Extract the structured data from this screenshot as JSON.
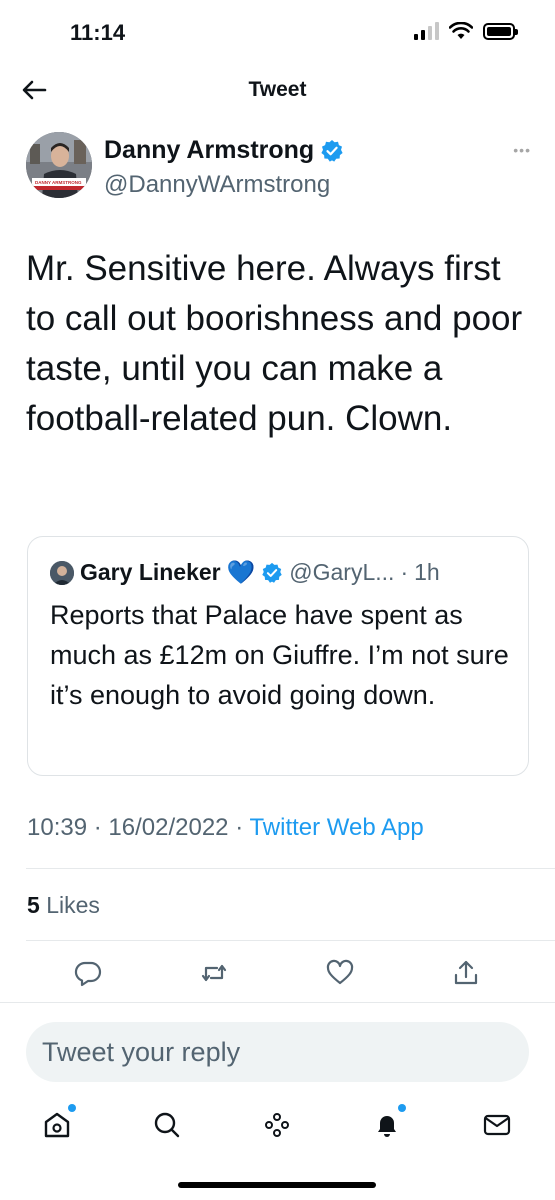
{
  "status_bar": {
    "time": "11:14"
  },
  "header": {
    "title": "Tweet"
  },
  "author": {
    "name": "Danny Armstrong",
    "handle": "@DannyWArmstrong",
    "avatar_caption": "DANNY ARMSTRONG"
  },
  "tweet": {
    "text": "Mr. Sensitive here. Always first to call out boorishness and poor taste, until you can make a football-related pun. Clown.",
    "time": "10:39",
    "date": "16/02/2022",
    "source": "Twitter Web App"
  },
  "quoted_tweet": {
    "name": "Gary Lineker",
    "emoji": "💙",
    "handle": "@GaryL...",
    "age": "1h",
    "text": "Reports that Palace have spent as much as £12m on Giuffre. I’m not sure it’s enough to avoid going down."
  },
  "stats": {
    "likes_count": "5",
    "likes_label": "Likes"
  },
  "reply": {
    "placeholder": "Tweet your reply"
  },
  "colors": {
    "accent": "#1d9bf0",
    "text": "#0f1419",
    "secondary": "#536471"
  },
  "icons": {
    "actions": [
      "reply-icon",
      "retweet-icon",
      "like-icon",
      "share-icon"
    ],
    "tabs": [
      "home-icon",
      "search-icon",
      "spaces-icon",
      "notifications-icon",
      "messages-icon"
    ]
  }
}
